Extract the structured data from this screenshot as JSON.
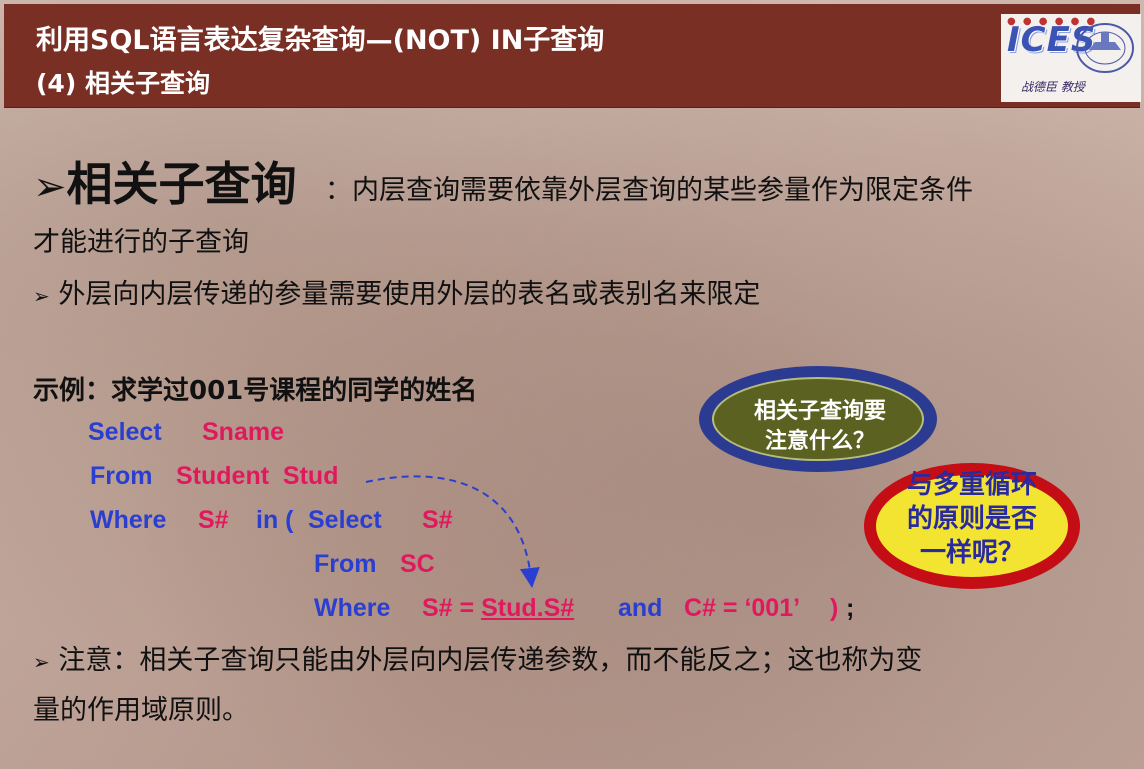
{
  "header": {
    "title_line1": "利用SQL语言表达复杂查询—(NOT) IN子查询",
    "title_line2": "(4) 相关子查询",
    "logo_text": "ICES",
    "logo_subtitle": "战德臣 教授"
  },
  "slide": {
    "bullet_arrow": "➢",
    "heading": "相关子查询",
    "heading_desc": "：内层查询需要依靠外层查询的某些参量作为限定条件",
    "heading_desc_cont": "才能进行的子查询",
    "bullet2": "外层向内层传递的参量需要使用外层的表名或表别名来限定",
    "example_label": "示例：求学过001号课程的同学的姓名",
    "code": {
      "l1_kw": "Select",
      "l1_col": "Sname",
      "l2_kw": "From",
      "l2_tbl": "Student  Stud",
      "l3_kw": "Where",
      "l3_col": "S#",
      "l3_in": "in (",
      "l3_select": "Select",
      "l3_col2": "S#",
      "l4_kw": "From",
      "l4_tbl": "SC",
      "l5_kw": "Where",
      "l5_cond1": "S# = ",
      "l5_ref": "Stud.S#",
      "l5_and": "and",
      "l5_cond2": "C# = ‘001’",
      "l5_close": ")",
      "l5_semi": ";"
    },
    "note_line1": "注意：相关子查询只能由外层向内层传递参数，而不能反之；这也称为变",
    "note_line2": "量的作用域原则。"
  },
  "callouts": {
    "bubble1_line1": "相关子查询要",
    "bubble1_line2": "注意什么？",
    "bubble2_line1": "与多重循环",
    "bubble2_line2": "的原则是否",
    "bubble2_line3": "一样呢？"
  },
  "colors": {
    "header_bg": "#7a2f24",
    "keyword": "#2a3fd0",
    "identifier": "#e0195e",
    "bubble1_ring": "#2c3b92",
    "bubble1_fill": "#5a6121",
    "bubble2_ring": "#c40d14",
    "bubble2_fill": "#f2e430"
  }
}
